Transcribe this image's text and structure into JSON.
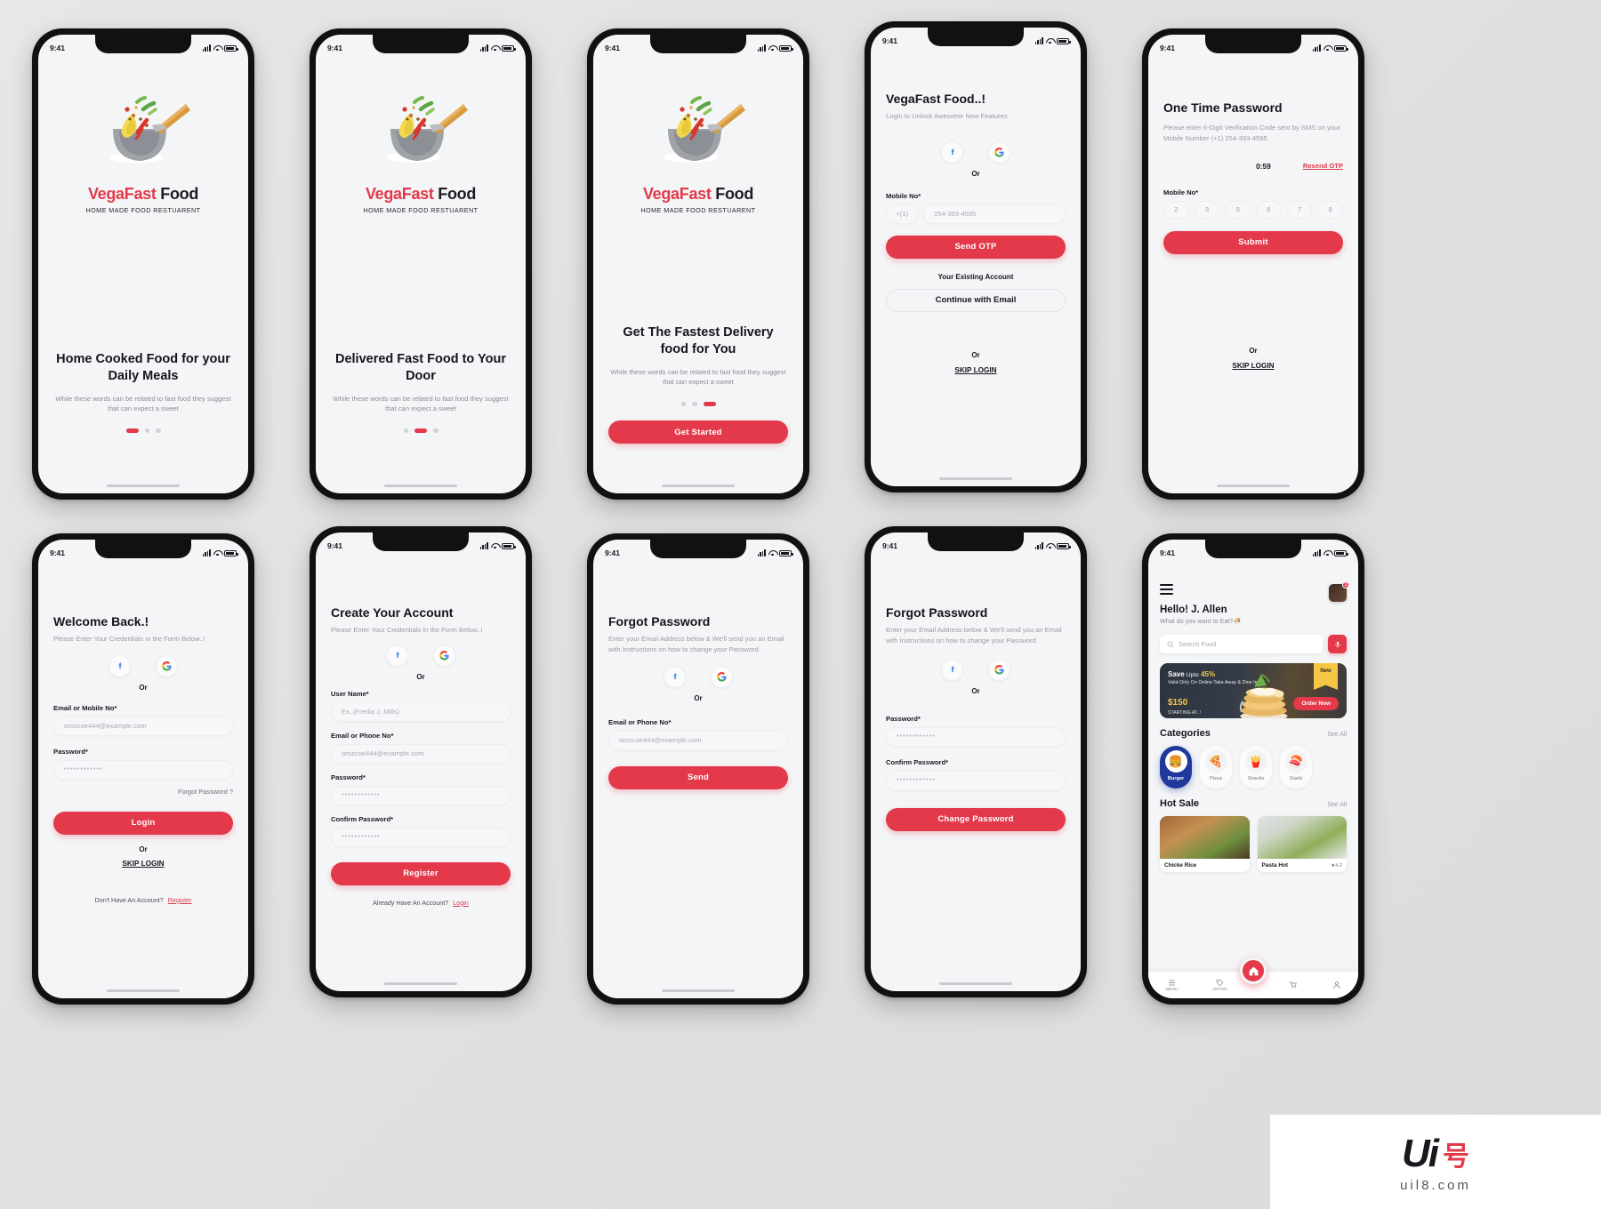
{
  "meta": {
    "status_time": "9:41",
    "accent": "#e3394a",
    "screen_bg": "#f4f5f7",
    "board_bg": "#e3e3e3"
  },
  "brand": {
    "name_red": "VegaFast",
    "name_dark": " Food",
    "tagline": "HOME MADE FOOD RESTUARENT"
  },
  "screens": [
    {
      "id": "onboarding-1",
      "title": "Home Cooked Food for your Daily Meals",
      "subtitle": "While these words can be related to fast food they suggest that can expect a sweet",
      "active_dot": 0
    },
    {
      "id": "onboarding-2",
      "title": "Delivered Fast Food to Your Door",
      "subtitle": "While these words can be related to fast food they suggest that can expect a sweet",
      "active_dot": 1
    },
    {
      "id": "onboarding-3",
      "title": "Get The Fastest Delivery food for You",
      "subtitle": "While these words can be related to fast food they suggest that can expect a sweet",
      "active_dot": 2,
      "cta": "Get Started"
    }
  ],
  "login_otp": {
    "title": "VegaFast Food..!",
    "subtitle": "Login to Unlock Awesome New Features",
    "or": "Or",
    "mobile_label": "Mobile No*",
    "country_code": "+(1)",
    "mobile_value": "254-393-4595",
    "send_otp": "Send OTP",
    "existing_account": "Your Existing Account",
    "continue_email": "Continue with Email",
    "skip": "SKIP LOGIN",
    "facebook_icon": "facebook-icon",
    "google_icon": "google-icon"
  },
  "otp": {
    "title": "One Time Password",
    "subtitle": "Please enter 6-Digit Verification Code sent by SMS on your Mobile Number (+1) 254-393-4595",
    "timer": "0:59",
    "resend": "Resend OTP",
    "mobile_label": "Mobile No*",
    "digits": [
      "2",
      "3",
      "5",
      "6",
      "7",
      "8"
    ],
    "submit": "Submit",
    "or": "Or",
    "skip": "SKIP LOGIN"
  },
  "login": {
    "title": "Welcome Back.!",
    "subtitle": "Please Enter Your Credentials in the Form Below..!",
    "or": "Or",
    "email_label": "Email or Mobile No*",
    "email_value": "orozcoe444@example.com",
    "password_label": "Password*",
    "password_value": "••••••••••••",
    "forgot": "Forgot Password ?",
    "login_btn": "Login",
    "skip": "SKIP LOGIN",
    "no_account": "Don't Have An Account?",
    "register_link": "Register"
  },
  "register": {
    "title": "Create Your Account",
    "subtitle": "Please Enter Your Credentials in the Form Below..!",
    "or": "Or",
    "username_label": "User Name*",
    "username_value": "Ex..(Fredia J. Mills)",
    "email_label": "Email or Phone No*",
    "email_value": "orozcoe444@example.com",
    "password_label": "Password*",
    "password_value": "••••••••••••",
    "confirm_label": "Confirm Password*",
    "confirm_value": "••••••••••••",
    "register_btn": "Register",
    "have_account": "Already Have An Account?",
    "login_link": "Login"
  },
  "forgot_email": {
    "title": "Forgot Password",
    "subtitle": "Enter your Email Address below & We'll send you an Email with Instructions on how to change your Password",
    "or": "Or",
    "email_label": "Email or Phone No*",
    "email_value": "orozcoe444@example.com",
    "send_btn": "Send"
  },
  "forgot_reset": {
    "title": "Forgot Password",
    "subtitle": "Enter your Email Address below & We'll send you an Email with Instructions on how to change your Password",
    "or": "Or",
    "password_label": "Password*",
    "password_value": "••••••••••••",
    "confirm_label": "Confirm Password*",
    "confirm_value": "••••••••••••",
    "change_btn": "Change Password"
  },
  "home": {
    "greeting": "Hello! J. Allen",
    "greeting_sub": "What do you want to Eat?",
    "greeting_emoji": "🍜",
    "notif_count": "1",
    "search_placeholder": "Search Food",
    "promo": {
      "save": "Save",
      "upto": "Upto",
      "percent": "45%",
      "valid": "Valid Only On Online Take Away & Dine In",
      "price": "$150",
      "starting": "STARTING AT..!",
      "ribbon": "New",
      "order_now": "Order Now"
    },
    "categories_title": "Categories",
    "categories_see_all": "See All",
    "categories": [
      {
        "label": "Burger",
        "icon": "🍔",
        "active": true
      },
      {
        "label": "Pizza",
        "icon": "🍕",
        "active": false
      },
      {
        "label": "Snacks",
        "icon": "🍟",
        "active": false
      },
      {
        "label": "Sushi",
        "icon": "🍣",
        "active": false
      }
    ],
    "hot_title": "Hot Sale",
    "hot_see_all": "See All",
    "hot_items": [
      {
        "name": "Chicke Rice",
        "rating": ""
      },
      {
        "name": "Pasta Hot",
        "rating": "★4.2"
      }
    ],
    "tabs": [
      {
        "label": "MENU",
        "icon": "menu-icon"
      },
      {
        "label": "OFFER",
        "icon": "offer-icon"
      },
      {
        "label": "",
        "icon": "cart-icon"
      },
      {
        "label": "",
        "icon": "profile-icon"
      }
    ],
    "fab_icon": "home-icon"
  },
  "watermark": {
    "ui": "Ui",
    "cn": "号",
    "sub": "uil8.com"
  }
}
